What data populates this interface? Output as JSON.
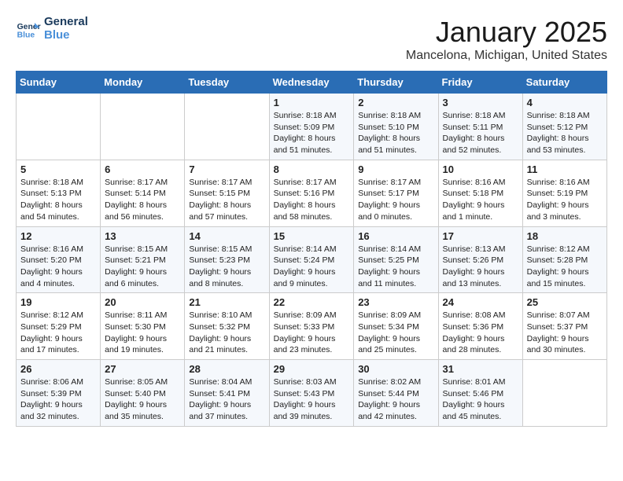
{
  "logo": {
    "text_general": "General",
    "text_blue": "Blue"
  },
  "header": {
    "title": "January 2025",
    "subtitle": "Mancelona, Michigan, United States"
  },
  "weekdays": [
    "Sunday",
    "Monday",
    "Tuesday",
    "Wednesday",
    "Thursday",
    "Friday",
    "Saturday"
  ],
  "weeks": [
    [
      {
        "day": "",
        "info": ""
      },
      {
        "day": "",
        "info": ""
      },
      {
        "day": "",
        "info": ""
      },
      {
        "day": "1",
        "info": "Sunrise: 8:18 AM\nSunset: 5:09 PM\nDaylight: 8 hours and 51 minutes."
      },
      {
        "day": "2",
        "info": "Sunrise: 8:18 AM\nSunset: 5:10 PM\nDaylight: 8 hours and 51 minutes."
      },
      {
        "day": "3",
        "info": "Sunrise: 8:18 AM\nSunset: 5:11 PM\nDaylight: 8 hours and 52 minutes."
      },
      {
        "day": "4",
        "info": "Sunrise: 8:18 AM\nSunset: 5:12 PM\nDaylight: 8 hours and 53 minutes."
      }
    ],
    [
      {
        "day": "5",
        "info": "Sunrise: 8:18 AM\nSunset: 5:13 PM\nDaylight: 8 hours and 54 minutes."
      },
      {
        "day": "6",
        "info": "Sunrise: 8:17 AM\nSunset: 5:14 PM\nDaylight: 8 hours and 56 minutes."
      },
      {
        "day": "7",
        "info": "Sunrise: 8:17 AM\nSunset: 5:15 PM\nDaylight: 8 hours and 57 minutes."
      },
      {
        "day": "8",
        "info": "Sunrise: 8:17 AM\nSunset: 5:16 PM\nDaylight: 8 hours and 58 minutes."
      },
      {
        "day": "9",
        "info": "Sunrise: 8:17 AM\nSunset: 5:17 PM\nDaylight: 9 hours and 0 minutes."
      },
      {
        "day": "10",
        "info": "Sunrise: 8:16 AM\nSunset: 5:18 PM\nDaylight: 9 hours and 1 minute."
      },
      {
        "day": "11",
        "info": "Sunrise: 8:16 AM\nSunset: 5:19 PM\nDaylight: 9 hours and 3 minutes."
      }
    ],
    [
      {
        "day": "12",
        "info": "Sunrise: 8:16 AM\nSunset: 5:20 PM\nDaylight: 9 hours and 4 minutes."
      },
      {
        "day": "13",
        "info": "Sunrise: 8:15 AM\nSunset: 5:21 PM\nDaylight: 9 hours and 6 minutes."
      },
      {
        "day": "14",
        "info": "Sunrise: 8:15 AM\nSunset: 5:23 PM\nDaylight: 9 hours and 8 minutes."
      },
      {
        "day": "15",
        "info": "Sunrise: 8:14 AM\nSunset: 5:24 PM\nDaylight: 9 hours and 9 minutes."
      },
      {
        "day": "16",
        "info": "Sunrise: 8:14 AM\nSunset: 5:25 PM\nDaylight: 9 hours and 11 minutes."
      },
      {
        "day": "17",
        "info": "Sunrise: 8:13 AM\nSunset: 5:26 PM\nDaylight: 9 hours and 13 minutes."
      },
      {
        "day": "18",
        "info": "Sunrise: 8:12 AM\nSunset: 5:28 PM\nDaylight: 9 hours and 15 minutes."
      }
    ],
    [
      {
        "day": "19",
        "info": "Sunrise: 8:12 AM\nSunset: 5:29 PM\nDaylight: 9 hours and 17 minutes."
      },
      {
        "day": "20",
        "info": "Sunrise: 8:11 AM\nSunset: 5:30 PM\nDaylight: 9 hours and 19 minutes."
      },
      {
        "day": "21",
        "info": "Sunrise: 8:10 AM\nSunset: 5:32 PM\nDaylight: 9 hours and 21 minutes."
      },
      {
        "day": "22",
        "info": "Sunrise: 8:09 AM\nSunset: 5:33 PM\nDaylight: 9 hours and 23 minutes."
      },
      {
        "day": "23",
        "info": "Sunrise: 8:09 AM\nSunset: 5:34 PM\nDaylight: 9 hours and 25 minutes."
      },
      {
        "day": "24",
        "info": "Sunrise: 8:08 AM\nSunset: 5:36 PM\nDaylight: 9 hours and 28 minutes."
      },
      {
        "day": "25",
        "info": "Sunrise: 8:07 AM\nSunset: 5:37 PM\nDaylight: 9 hours and 30 minutes."
      }
    ],
    [
      {
        "day": "26",
        "info": "Sunrise: 8:06 AM\nSunset: 5:39 PM\nDaylight: 9 hours and 32 minutes."
      },
      {
        "day": "27",
        "info": "Sunrise: 8:05 AM\nSunset: 5:40 PM\nDaylight: 9 hours and 35 minutes."
      },
      {
        "day": "28",
        "info": "Sunrise: 8:04 AM\nSunset: 5:41 PM\nDaylight: 9 hours and 37 minutes."
      },
      {
        "day": "29",
        "info": "Sunrise: 8:03 AM\nSunset: 5:43 PM\nDaylight: 9 hours and 39 minutes."
      },
      {
        "day": "30",
        "info": "Sunrise: 8:02 AM\nSunset: 5:44 PM\nDaylight: 9 hours and 42 minutes."
      },
      {
        "day": "31",
        "info": "Sunrise: 8:01 AM\nSunset: 5:46 PM\nDaylight: 9 hours and 45 minutes."
      },
      {
        "day": "",
        "info": ""
      }
    ]
  ]
}
